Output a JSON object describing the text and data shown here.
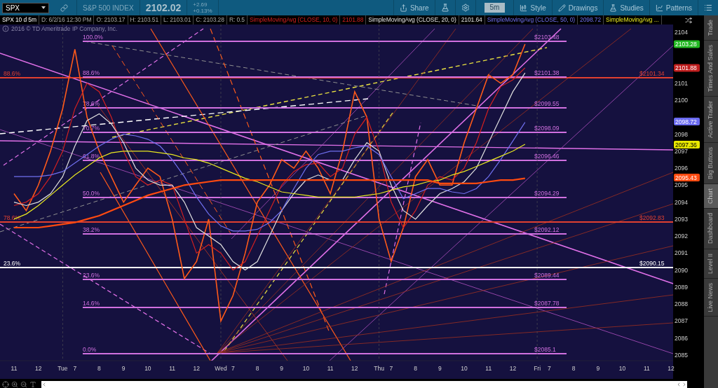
{
  "toolbar": {
    "symbol": "SPX",
    "instrument": "S&P 500 INDEX",
    "last": "2102.02",
    "change": "+2.69",
    "change_percent": "+0.13%",
    "buttons": [
      {
        "kind": "labeled",
        "label": "Share"
      },
      {
        "kind": "icon"
      },
      {
        "kind": "icon"
      },
      {
        "kind": "interval",
        "label": "5m"
      },
      {
        "kind": "labeled",
        "label": "Style"
      },
      {
        "kind": "labeled",
        "label": "Drawings"
      },
      {
        "kind": "labeled",
        "label": "Studies"
      },
      {
        "kind": "labeled",
        "label": "Patterns"
      },
      {
        "kind": "icon"
      }
    ]
  },
  "info_bar": {
    "fields": [
      {
        "kind": "title",
        "text": "SPX 10 d 5m"
      },
      {
        "kind": "field",
        "text": "D: 6/2/16 12:30 PM"
      },
      {
        "kind": "field",
        "text": "O: 2103.17"
      },
      {
        "kind": "field",
        "text": "H: 2103.51"
      },
      {
        "kind": "field",
        "text": "L: 2103.01"
      },
      {
        "kind": "field",
        "text": "C: 2103.28"
      },
      {
        "kind": "field",
        "text": "R: 0.5"
      }
    ],
    "study_values": [
      "2101.88",
      "2101.64",
      "2098.72"
    ]
  },
  "chart": {
    "copyright": "2016 © TD Ameritrade IP Company, Inc.",
    "chart_data": {
      "type": "line",
      "grid": true,
      "ylim": [
        2084.5,
        2104.5
      ],
      "categories": [
        "11",
        null,
        "12",
        null,
        "Tue",
        "7",
        null,
        "8",
        null,
        "9",
        null,
        "10",
        null,
        "11",
        null,
        "12",
        null,
        "Wed",
        "7",
        null,
        "8",
        null,
        "9",
        null,
        "10",
        null,
        "11",
        null,
        "12",
        null,
        "Thu",
        "7",
        null,
        "8",
        null,
        "9",
        null,
        "10",
        null,
        "11",
        null,
        "12",
        null,
        "Fri",
        "7",
        null,
        "8",
        null,
        "9",
        null,
        "10",
        null,
        "11",
        null,
        "12"
      ],
      "series": [
        {
          "color": "#ff5a1a",
          "values": [
            2094.5,
            2093.5,
            2095,
            2097,
            2099.5,
            2103,
            2099,
            2097,
            2095.5,
            2094,
            2095,
            2096,
            2095.5,
            2093,
            2089.5,
            2090.5,
            2093,
            2087,
            2088.5,
            2091,
            2094,
            2095,
            2096.5,
            2096,
            2097,
            2096,
            2094.5,
            2097,
            2100.5,
            2099,
            2093,
            2090.5,
            2092.5,
            2095.5,
            2096.5,
            2095,
            2095,
            2097.5,
            2099.5,
            2101.5,
            2101,
            2101.5,
            2103.3,
            null,
            null,
            null,
            null,
            null,
            null,
            null,
            null,
            null,
            null,
            null,
            null
          ]
        },
        {
          "name": "SimpleMovingAvg (CLOSE, 10, 0)",
          "color": "#d42020",
          "values": [
            2093.8,
            2094,
            2094.5,
            2095.5,
            2097,
            2099.5,
            2101,
            2100.5,
            2099,
            2097,
            2095.5,
            2095,
            2095.3,
            2095,
            2093,
            2091,
            2091.5,
            2091,
            2090,
            2090.5,
            2092,
            2093.5,
            2095,
            2095.8,
            2096.2,
            2096.3,
            2095.5,
            2096,
            2098,
            2099,
            2097,
            2094,
            2092.5,
            2093.5,
            2095,
            2095.5,
            2095.3,
            2096,
            2097.5,
            2099.5,
            2100.8,
            2101.2,
            2101.9,
            null,
            null,
            null,
            null,
            null,
            null,
            null,
            null,
            null,
            null,
            null,
            null
          ]
        },
        {
          "name": "SimpleMovingAvg (CLOSE, 20, 0)",
          "color": "#e0e0e0",
          "values": [
            2094,
            2093.8,
            2094,
            2094.5,
            2095.5,
            2097.3,
            2098.8,
            2099.2,
            2098.6,
            2097.5,
            2096,
            2095.3,
            2095,
            2095,
            2094,
            2092.5,
            2092,
            2091.5,
            2090.5,
            2090,
            2090.5,
            2092,
            2093.5,
            2094.5,
            2095.3,
            2095.6,
            2095.3,
            2095.3,
            2096.5,
            2097.5,
            2097,
            2095,
            2093.5,
            2093,
            2093.8,
            2094.5,
            2094.8,
            2095.2,
            2096,
            2097.5,
            2099,
            2100.5,
            2101.6,
            null,
            null,
            null,
            null,
            null,
            null,
            null,
            null,
            null,
            null,
            null,
            null
          ]
        },
        {
          "name": "SimpleMovingAvg (CLOSE, 50, 0)",
          "color": "#7070f0",
          "values": [
            2095.5,
            2095.5,
            2095.5,
            2095.6,
            2095.8,
            2096.3,
            2096.8,
            2097.3,
            2097.7,
            2098,
            2097.9,
            2097.7,
            2097.3,
            2096.5,
            2095.5,
            2094.3,
            2093.3,
            2092.6,
            2092.3,
            2092.3,
            2092.4,
            2092.8,
            2093.5,
            2094.8,
            2096,
            2096.8,
            2097,
            2097,
            2097.2,
            2097.3,
            2096.8,
            2095.5,
            2094.2,
            2094.5,
            2094.8,
            2094.8,
            2094.6,
            2094.5,
            2094.8,
            2095.5,
            2096.5,
            2097.6,
            2098.7,
            null,
            null,
            null,
            null,
            null,
            null,
            null,
            null,
            null,
            null,
            null,
            null
          ]
        },
        {
          "name": "SimpleMovingAvg ...",
          "color": "#e8e820",
          "values": [
            2093,
            2093.3,
            2093.8,
            2094.4,
            2095,
            2095.6,
            2096.1,
            2096.6,
            2096.9,
            2097,
            2097,
            2097,
            2096.9,
            2096.8,
            2096.6,
            2096.5,
            2096.3,
            2096,
            2095.7,
            2095.4,
            2095.2,
            2094.9,
            2094.6,
            2094.5,
            2094.4,
            2094.3,
            2094.3,
            2094.3,
            2094.3,
            2094.4,
            2094.5,
            2094.7,
            2094.9,
            2095,
            2095.2,
            2095.3,
            2095.6,
            2095.8,
            2096.1,
            2096.4,
            2096.7,
            2097,
            2097.4,
            null,
            null,
            null,
            null,
            null,
            null,
            null,
            null,
            null,
            null,
            null,
            null
          ]
        },
        {
          "color": "#ff4a10",
          "values": [
            2092.5,
            2092.5,
            2092.5,
            2092.6,
            2092.7,
            2092.8,
            2093,
            2093.2,
            2093.5,
            2093.8,
            2094.1,
            2094.4,
            2094.6,
            2094.8,
            2095,
            2095.1,
            2095.2,
            2095.3,
            2095.3,
            2095.3,
            2095.3,
            2095.3,
            2095.3,
            2095.3,
            2095.3,
            2095.3,
            2095.3,
            2095.3,
            2095.3,
            2095.3,
            2095.3,
            2095.3,
            2095.3,
            2095.3,
            2095.3,
            2095.1,
            2095.1,
            2095.1,
            2095.1,
            2095.2,
            2095.3,
            2095.3,
            2095.4,
            null,
            null,
            null,
            null,
            null,
            null,
            null,
            null,
            null,
            null,
            null,
            null
          ]
        }
      ],
      "yticks": [
        2085,
        2086,
        2087,
        2088,
        2089,
        2090,
        2091,
        2092,
        2093,
        2094,
        2095,
        2096,
        2097,
        2098,
        2100,
        2101,
        2104
      ]
    },
    "fib_levels": [
      {
        "kind": "inner",
        "percent": "100.0%",
        "price": "$2103.48",
        "color": "#d070e0"
      },
      {
        "kind": "full",
        "percent": "88.6%",
        "price": "$2101.34",
        "color": "#e04030"
      },
      {
        "kind": "inner",
        "percent": "88.6%",
        "price": "$2101.38",
        "color": "#d070e0"
      },
      {
        "kind": "inner",
        "percent": "78.6%",
        "price": "$2099.55",
        "color": "#d070e0"
      },
      {
        "kind": "inner",
        "percent": "70.7%",
        "price": "$2098.09",
        "color": "#d070e0"
      },
      {
        "kind": "inner",
        "percent": "61.8%",
        "price": "$2096.46",
        "color": "#d070e0"
      },
      {
        "kind": "inner",
        "percent": "50.0%",
        "price": "$2094.29",
        "color": "#d070e0"
      },
      {
        "kind": "full",
        "percent": "78.6%",
        "price": "$2092.83",
        "color": "#e04030"
      },
      {
        "kind": "inner",
        "percent": "38.2%",
        "price": "$2092.12",
        "color": "#d070e0"
      },
      {
        "kind": "full",
        "percent": "23.6%",
        "price": "$2090.15",
        "color": "#ffffff"
      },
      {
        "kind": "inner",
        "percent": "23.6%",
        "price": "$2089.44",
        "color": "#d070e0"
      },
      {
        "kind": "inner",
        "percent": "14.6%",
        "price": "$2087.78",
        "color": "#d070e0"
      },
      {
        "kind": "inner",
        "percent": "0.0%",
        "price": "$2085.1",
        "color": "#d070e0"
      }
    ],
    "badges": [
      {
        "text": "2103.28",
        "color": "#22b822"
      },
      {
        "text": "2101.88",
        "color": "#c01e1e"
      },
      {
        "text": "2098.72",
        "color": "#6a6af0"
      },
      {
        "text": "2097.36",
        "color": "#e8e800"
      },
      {
        "text": "2095.43",
        "color": "#ff4a10"
      }
    ]
  },
  "side_tabs": [
    {
      "label": "Trade",
      "selected": false
    },
    {
      "label": "Times And Sales",
      "selected": false
    },
    {
      "label": "Active Trader",
      "selected": false
    },
    {
      "label": "Big Buttons",
      "selected": false
    },
    {
      "label": "Chart",
      "selected": true
    },
    {
      "label": "Dashboard",
      "selected": false
    },
    {
      "label": "Level II",
      "selected": false
    },
    {
      "label": "Live News",
      "selected": false
    }
  ]
}
